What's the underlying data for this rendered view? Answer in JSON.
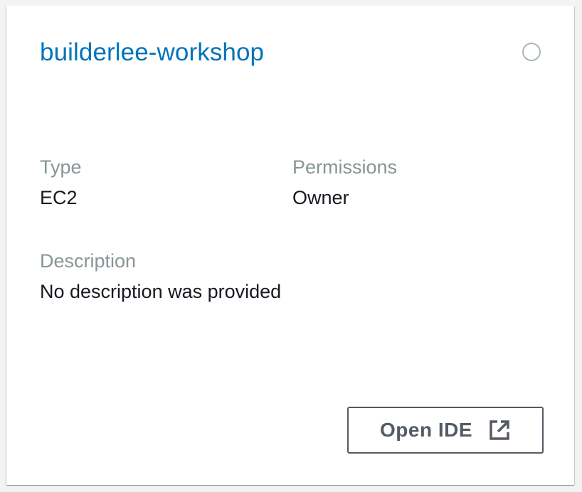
{
  "environment": {
    "name": "builderlee-workshop",
    "type_label": "Type",
    "type_value": "EC2",
    "permissions_label": "Permissions",
    "permissions_value": "Owner",
    "description_label": "Description",
    "description_value": "No description was provided"
  },
  "actions": {
    "open_ide_label": "Open IDE",
    "open_ide_icon": "external-link-icon"
  },
  "colors": {
    "link": "#0073bb",
    "label": "#879596",
    "text": "#16191f",
    "button_border": "#545b64",
    "radio_border": "#aab7b8"
  }
}
